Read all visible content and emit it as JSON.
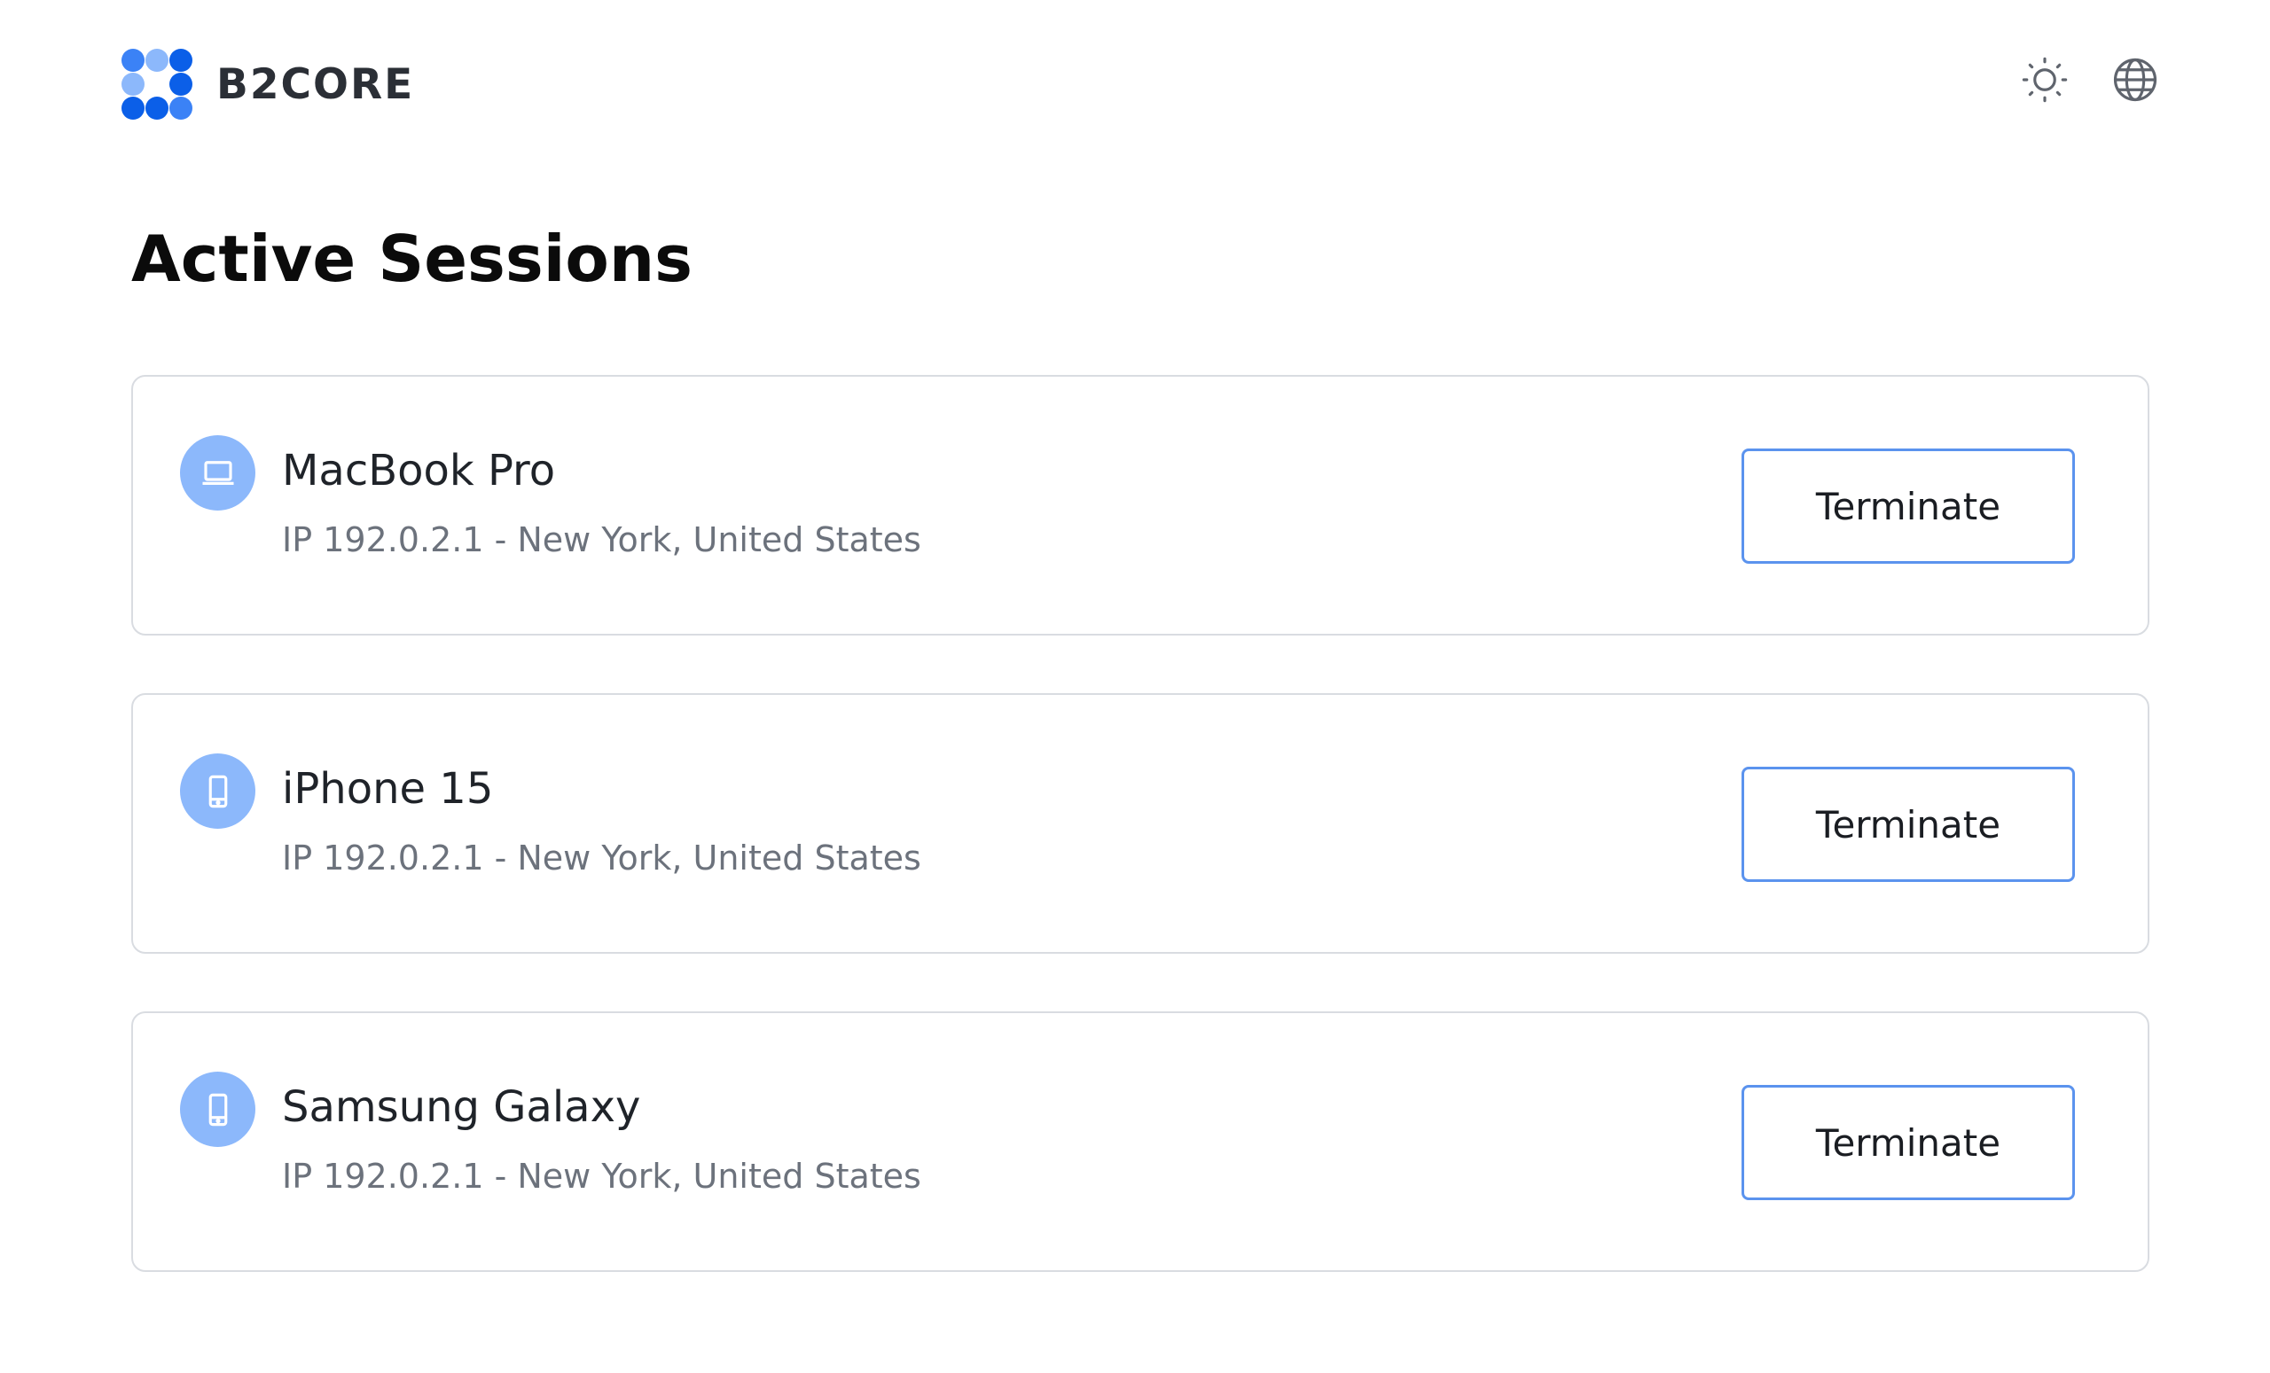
{
  "brand": {
    "name": "B2CORE",
    "logo_icon": "b2core-dots-logo",
    "logo_colors": {
      "dark": "#0b5fe8",
      "light": "#8cb8fb"
    }
  },
  "header": {
    "theme_toggle_icon": "sun-icon",
    "language_icon": "globe-icon"
  },
  "page": {
    "title": "Active Sessions"
  },
  "sessions": [
    {
      "device_name": "MacBook Pro",
      "device_icon": "laptop-icon",
      "details": "IP 192.0.2.1 - New York, United States",
      "action_label": "Terminate"
    },
    {
      "device_name": "iPhone 15",
      "device_icon": "phone-icon",
      "details": "IP 192.0.2.1 - New York, United States",
      "action_label": "Terminate"
    },
    {
      "device_name": "Samsung Galaxy",
      "device_icon": "phone-icon",
      "details": "IP 192.0.2.1 - New York, United States",
      "action_label": "Terminate"
    }
  ],
  "colors": {
    "accent": "#5b93ee",
    "avatar_bg": "#8cb8fb",
    "border": "#d9dce1",
    "muted_text": "#6c727c"
  }
}
